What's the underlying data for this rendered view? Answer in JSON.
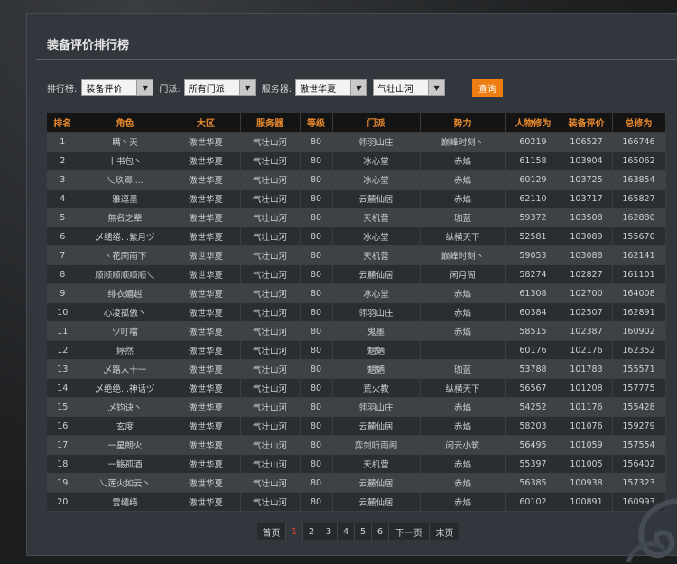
{
  "title": "装备评价排行榜",
  "filters": {
    "rank_label": "排行榜:",
    "rank_value": "装备评价",
    "faction_label": "门派:",
    "faction_value": "所有门派",
    "server_label": "服务器:",
    "region_value": "傲世华夏",
    "server_value": "气壮山河",
    "query_label": "查询"
  },
  "table": {
    "headers": [
      "排名",
      "角色",
      "大区",
      "服务器",
      "等级",
      "门派",
      "势力",
      "人物修为",
      "装备评价",
      "总修为"
    ],
    "rows": [
      [
        "1",
        "瞒丶天",
        "傲世华夏",
        "气壮山河",
        "80",
        "翎羽山庄",
        "巅峰时刻丶",
        "60219",
        "106527",
        "166746"
      ],
      [
        "2",
        "丨书包丶",
        "傲世华夏",
        "气壮山河",
        "80",
        "冰心堂",
        "赤焰",
        "61158",
        "103904",
        "165062"
      ],
      [
        "3",
        "乀玖卿....",
        "傲世华夏",
        "气壮山河",
        "80",
        "冰心堂",
        "赤焰",
        "60129",
        "103725",
        "163854"
      ],
      [
        "4",
        "雅逗墨",
        "傲世华夏",
        "气壮山河",
        "80",
        "云麓仙居",
        "赤焰",
        "62110",
        "103717",
        "165827"
      ],
      [
        "5",
        "無名之辈",
        "傲世华夏",
        "气壮山河",
        "80",
        "天机营",
        "珈蓝",
        "59372",
        "103508",
        "162880"
      ],
      [
        "6",
        "乄缱绻...紫月ヅ",
        "傲世华夏",
        "气壮山河",
        "80",
        "冰心堂",
        "纵横天下",
        "52581",
        "103089",
        "155670"
      ],
      [
        "7",
        "丶花閑雨下",
        "傲世华夏",
        "气壮山河",
        "80",
        "天机营",
        "巅峰时刻丶",
        "59053",
        "103088",
        "162141"
      ],
      [
        "8",
        "顺顺顺顺顺顺乀",
        "傲世华夏",
        "气壮山河",
        "80",
        "云麓仙居",
        "闲月阁",
        "58274",
        "102827",
        "161101"
      ],
      [
        "9",
        "绯衣媚赳",
        "傲世华夏",
        "气壮山河",
        "80",
        "冰心堂",
        "赤焰",
        "61308",
        "102700",
        "164008"
      ],
      [
        "10",
        "心凌孤傲丶",
        "傲世华夏",
        "气壮山河",
        "80",
        "翎羽山庄",
        "赤焰",
        "60384",
        "102507",
        "162891"
      ],
      [
        "11",
        "ヅ叮噹",
        "傲世华夏",
        "气壮山河",
        "80",
        "鬼墨",
        "赤焰",
        "58515",
        "102387",
        "160902"
      ],
      [
        "12",
        "婷然",
        "傲世华夏",
        "气壮山河",
        "80",
        "魍魉",
        "",
        "60176",
        "102176",
        "162352"
      ],
      [
        "13",
        "乄路人十一",
        "傲世华夏",
        "气壮山河",
        "80",
        "魍魉",
        "珈蓝",
        "53788",
        "101783",
        "155571"
      ],
      [
        "14",
        "乄绝绝...神话ヅ",
        "傲世华夏",
        "气壮山河",
        "80",
        "荒火教",
        "纵横天下",
        "56567",
        "101208",
        "157775"
      ],
      [
        "15",
        "乄钧诀丶",
        "傲世华夏",
        "气壮山河",
        "80",
        "翎羽山庄",
        "赤焰",
        "54252",
        "101176",
        "155428"
      ],
      [
        "16",
        "玄度",
        "傲世华夏",
        "气壮山河",
        "80",
        "云麓仙居",
        "赤焰",
        "58203",
        "101076",
        "159279"
      ],
      [
        "17",
        "一星朗火",
        "傲世华夏",
        "气壮山河",
        "80",
        "弈剑听雨阁",
        "闲云小筑",
        "56495",
        "101059",
        "157554"
      ],
      [
        "18",
        "一觞孤酒",
        "傲世华夏",
        "气壮山河",
        "80",
        "天机营",
        "赤焰",
        "55397",
        "101005",
        "156402"
      ],
      [
        "19",
        "乀莲火如云丶",
        "傲世华夏",
        "气壮山河",
        "80",
        "云麓仙居",
        "赤焰",
        "56385",
        "100938",
        "157323"
      ],
      [
        "20",
        "雲缱绻",
        "傲世华夏",
        "气壮山河",
        "80",
        "云麓仙居",
        "赤焰",
        "60102",
        "100891",
        "160993"
      ]
    ]
  },
  "pager": {
    "first": "首页",
    "pages": [
      "1",
      "2",
      "3",
      "4",
      "5",
      "6"
    ],
    "current": "1",
    "next": "下一页",
    "last": "末页"
  },
  "colors": {
    "accent": "#ee7e12",
    "header_text": "#e8892c",
    "current_page": "#e23e2e"
  }
}
